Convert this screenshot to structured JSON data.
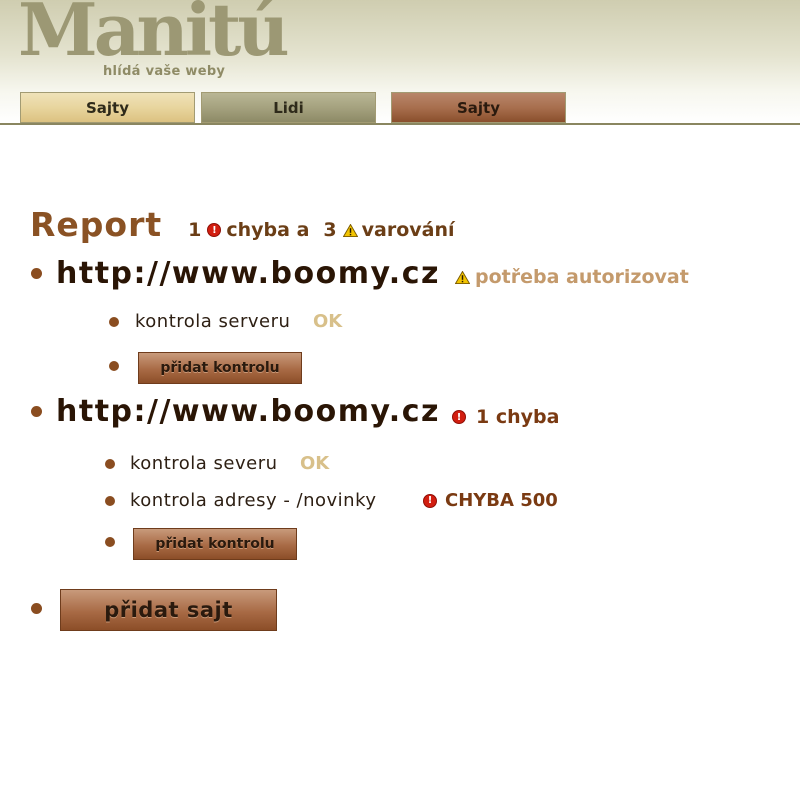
{
  "header": {
    "logo": "Manitú",
    "tagline": "hlídá vaše weby"
  },
  "tabs": [
    {
      "label": "Sajty"
    },
    {
      "label": "Lidi"
    },
    {
      "label": "Sajty"
    }
  ],
  "report": {
    "title": "Report",
    "error_count": "1",
    "error_word": "chyba a",
    "warning_count": "3",
    "warning_word": "varování"
  },
  "sites": [
    {
      "url": "http://www.boomy.cz",
      "status": "potřeba autorizovat",
      "status_icon": "warning-icon",
      "checks": [
        {
          "label": "kontrola serveru",
          "result": "OK"
        }
      ],
      "add_check_label": "přidat kontrolu"
    },
    {
      "url": "http://www.boomy.cz",
      "status": "1 chyba",
      "status_icon": "error-icon",
      "checks": [
        {
          "label": "kontrola severu",
          "result": "OK"
        },
        {
          "label": "kontrola adresy - /novinky",
          "result": "CHYBA 500",
          "result_icon": "error-icon"
        }
      ],
      "add_check_label": "přidat kontrolu"
    }
  ],
  "add_site_label": "přidat sajt",
  "colors": {
    "accent_brown": "#8a5224",
    "ok": "#d8c08a",
    "error": "#d21e10",
    "warning": "#f2c400"
  }
}
